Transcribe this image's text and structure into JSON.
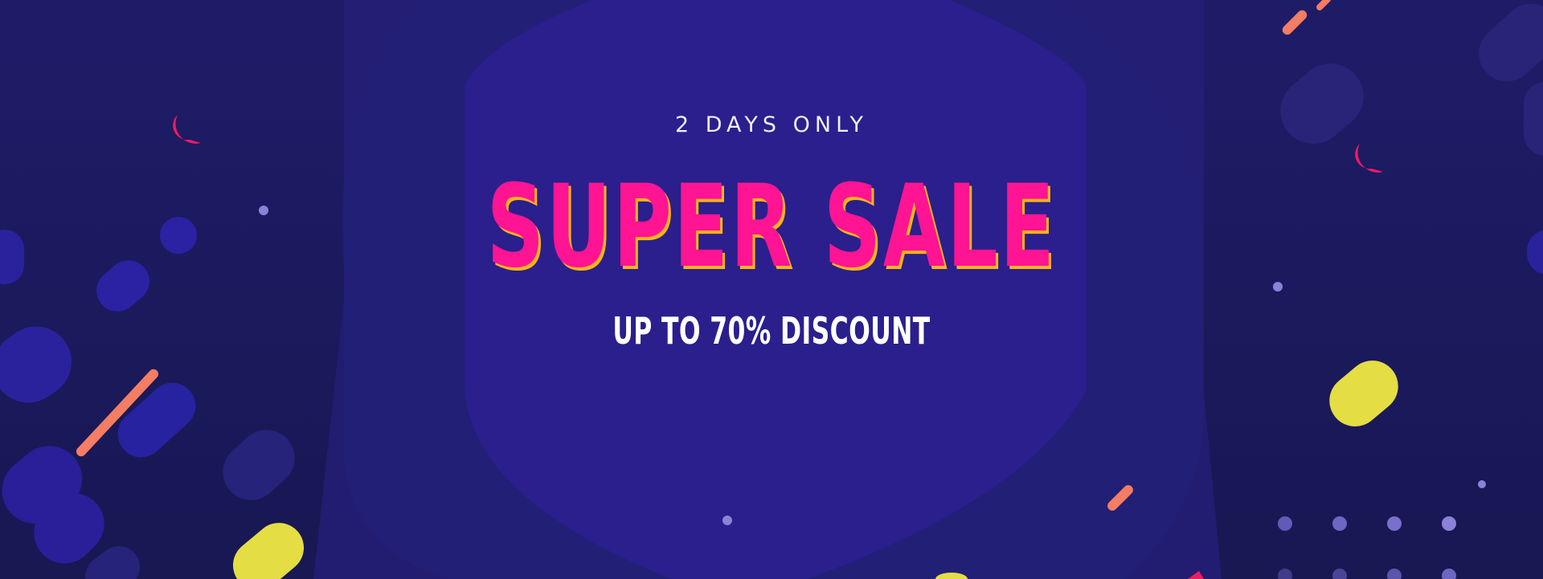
{
  "banner": {
    "kicker": "2 DAYS ONLY",
    "title": "SUPER SALE",
    "subtitle": "UP TO 70% DISCOUNT"
  },
  "colors": {
    "background": "#1b1a5c",
    "panel": "#24207a",
    "accent_pink": "#ff1493",
    "accent_yellow": "#f7b51a",
    "accent_orange": "#f47d63",
    "accent_yellow_shape": "#e4dd44",
    "accent_red": "#ef1b61",
    "dot": "#8a83d9"
  }
}
